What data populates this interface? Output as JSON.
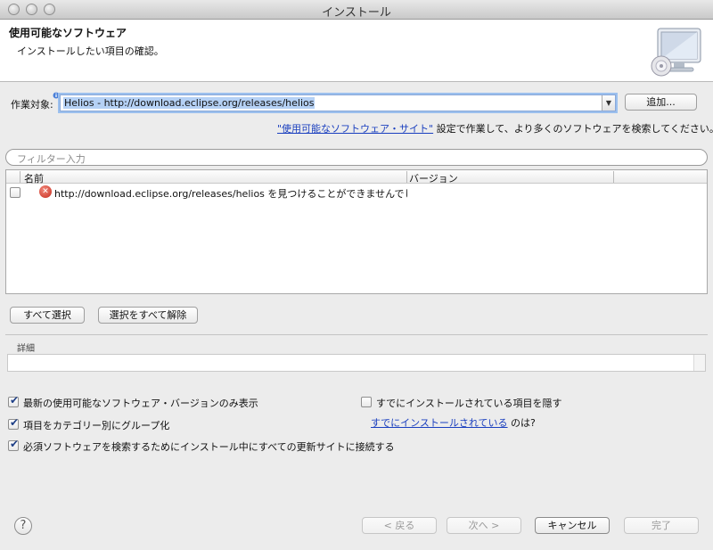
{
  "window": {
    "title": "インストール"
  },
  "banner": {
    "title": "使用可能なソフトウェア",
    "description": "インストールしたい項目の確認。"
  },
  "work_with": {
    "label": "作業対象:",
    "value": "Helios - http://download.eclipse.org/releases/helios",
    "add_label": "追加..."
  },
  "hint": {
    "link": "\"使用可能なソフトウェア・サイト\"",
    "text": " 設定で作業して、より多くのソフトウェアを検索してください。"
  },
  "filter": {
    "placeholder": "フィルター入力"
  },
  "table": {
    "columns": [
      "名前",
      "バージョン"
    ],
    "rows": [
      {
        "name": "http://download.eclipse.org/releases/helios を見つけることができませんでした",
        "version": ""
      }
    ]
  },
  "selection_buttons": {
    "select_all": "すべて選択",
    "deselect_all": "選択をすべて解除"
  },
  "details": {
    "label": "詳細"
  },
  "options": {
    "latest_only": {
      "label": "最新の使用可能なソフトウェア・バージョンのみ表示",
      "checked": true
    },
    "group_by_category": {
      "label": "項目をカテゴリー別にグループ化",
      "checked": true
    },
    "contact_all_sites": {
      "label": "必須ソフトウェアを検索するためにインストール中にすべての更新サイトに接続する",
      "checked": true
    },
    "hide_installed": {
      "label": "すでにインストールされている項目を隠す",
      "checked": false
    },
    "installed_link": "すでにインストールされている",
    "installed_suffix": " のは?"
  },
  "footer": {
    "help": "?",
    "back": "< 戻る",
    "next": "次へ >",
    "cancel": "キャンセル",
    "finish": "完了"
  }
}
